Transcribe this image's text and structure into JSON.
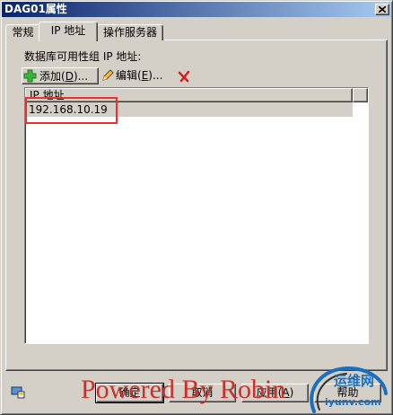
{
  "window": {
    "title": "DAG01属性",
    "close_icon": "close-x-icon"
  },
  "tabs": [
    {
      "label": "常规",
      "selected": false
    },
    {
      "label": "IP 地址",
      "selected": true
    },
    {
      "label": "操作服务器",
      "selected": false
    }
  ],
  "ip_page": {
    "group_label": "数据库可用性组 IP 地址:",
    "toolbar": {
      "add": {
        "text_before": "添加(",
        "accel": "D",
        "text_after": ")...",
        "icon": "green-plus-icon"
      },
      "edit": {
        "text_before": "编辑(",
        "accel": "E",
        "text_after": ")...",
        "icon": "pencil-icon"
      },
      "remove": {
        "icon": "red-x-icon"
      }
    },
    "list": {
      "columns": [
        "IP 地址"
      ],
      "rows": [
        {
          "ip": "192.168.10.19",
          "selected": true
        }
      ]
    }
  },
  "footer": {
    "ok": "确定",
    "cancel": "取消",
    "apply": {
      "text_before": "应用(",
      "accel": "A",
      "text_after": ")"
    },
    "help": "帮助",
    "status_icon": "network-properties-icon"
  },
  "overlay": {
    "watermark": "Powered By Robin",
    "logo": {
      "name": "运维网",
      "domain": "iyunv.com"
    }
  },
  "colors": {
    "title_bar_start": "#0a246a",
    "title_bar_end": "#a6caf0",
    "face": "#d4d0c8",
    "annotation_red": "#e8302e",
    "watermark_red": "#c8302c",
    "logo_blue": "#1a6fc0"
  }
}
